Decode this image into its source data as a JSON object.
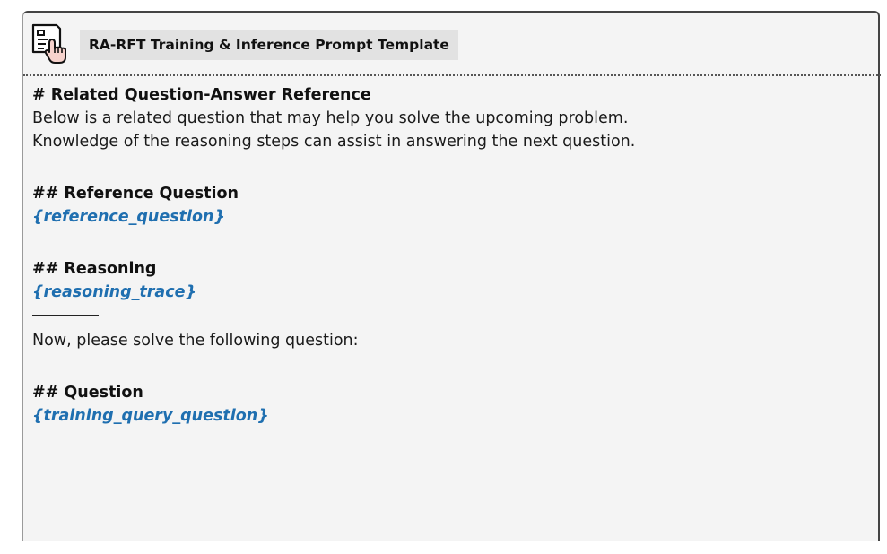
{
  "header": {
    "icon": "document-pointer-icon",
    "title": "RA-RFT Training & Inference Prompt Template"
  },
  "sections": {
    "related_heading": "# Related Question-Answer Reference",
    "intro_line1": "Below is a related question that may help you solve the upcoming problem.",
    "intro_line2": "Knowledge of the reasoning steps can assist in answering the next question.",
    "reference_heading": "## Reference Question",
    "reference_placeholder": "{reference_question}",
    "reasoning_heading": "## Reasoning",
    "reasoning_placeholder": "{reasoning_trace}",
    "now_line": "Now, please solve the following question:",
    "question_heading": "## Question",
    "question_placeholder": "{training_query_question}"
  },
  "colors": {
    "placeholder": "#1f6fb0",
    "card_background": "#f4f4f4",
    "title_background": "#e2e2e2"
  }
}
